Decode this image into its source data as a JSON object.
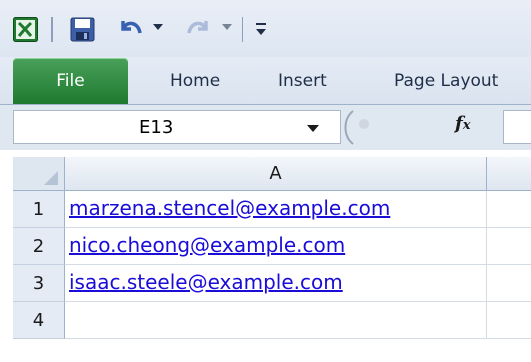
{
  "quick_access": {
    "icons": [
      "excel-icon",
      "save-icon",
      "undo-icon",
      "redo-icon",
      "customize-qat-icon"
    ]
  },
  "ribbon": {
    "tabs": [
      {
        "label": "File",
        "active": true
      },
      {
        "label": "Home"
      },
      {
        "label": "Insert"
      },
      {
        "label": "Page Layout"
      }
    ]
  },
  "formula_bar": {
    "name_box": "E13",
    "fx_label": "fx",
    "formula": ""
  },
  "sheet": {
    "columns": [
      "A"
    ],
    "rows": [
      {
        "num": "1",
        "a": "marzena.stencel@example.com"
      },
      {
        "num": "2",
        "a": "nico.cheong@example.com"
      },
      {
        "num": "3",
        "a": "isaac.steele@example.com"
      },
      {
        "num": "4",
        "a": ""
      }
    ]
  },
  "colors": {
    "file_tab": "#2a8a3c",
    "link_text": "#1a0dd8",
    "header_bg": "#dee6f0"
  }
}
